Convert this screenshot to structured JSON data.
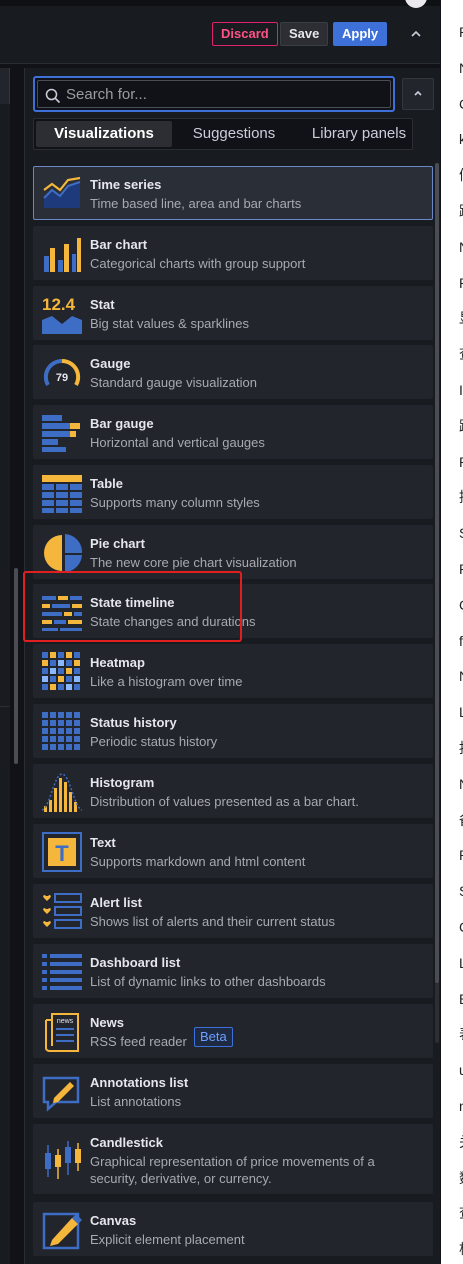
{
  "toolbar": {
    "discard_label": "Discard",
    "save_label": "Save",
    "apply_label": "Apply",
    "collapse_glyph": "⌃"
  },
  "search": {
    "placeholder": "Search for...",
    "value": ""
  },
  "collapse_glyph": "⌃",
  "tabs": [
    {
      "label": "Visualizations",
      "active": true
    },
    {
      "label": "Suggestions",
      "active": false
    },
    {
      "label": "Library panels",
      "active": false
    }
  ],
  "visualizations": [
    {
      "name": "Time series",
      "description": "Time based line, area and bar charts",
      "icon": "time-series-icon",
      "selected": true
    },
    {
      "name": "Bar chart",
      "description": "Categorical charts with group support",
      "icon": "bar-chart-icon"
    },
    {
      "name": "Stat",
      "description": "Big stat values & sparklines",
      "icon": "stat-icon",
      "icon_text": "12.4"
    },
    {
      "name": "Gauge",
      "description": "Standard gauge visualization",
      "icon": "gauge-icon",
      "icon_text": "79"
    },
    {
      "name": "Bar gauge",
      "description": "Horizontal and vertical gauges",
      "icon": "bar-gauge-icon"
    },
    {
      "name": "Table",
      "description": "Supports many column styles",
      "icon": "table-icon"
    },
    {
      "name": "Pie chart",
      "description": "The new core pie chart visualization",
      "icon": "pie-chart-icon"
    },
    {
      "name": "State timeline",
      "description": "State changes and durations",
      "icon": "state-timeline-icon",
      "highlighted": true
    },
    {
      "name": "Heatmap",
      "description": "Like a histogram over time",
      "icon": "heatmap-icon"
    },
    {
      "name": "Status history",
      "description": "Periodic status history",
      "icon": "status-history-icon"
    },
    {
      "name": "Histogram",
      "description": "Distribution of values presented as a bar chart.",
      "icon": "histogram-icon"
    },
    {
      "name": "Text",
      "description": "Supports markdown and html content",
      "icon": "text-icon",
      "icon_text": "T"
    },
    {
      "name": "Alert list",
      "description": "Shows list of alerts and their current status",
      "icon": "alert-list-icon"
    },
    {
      "name": "Dashboard list",
      "description": "List of dynamic links to other dashboards",
      "icon": "dashboard-list-icon"
    },
    {
      "name": "News",
      "description": "RSS feed reader",
      "icon": "news-icon",
      "icon_text": "news",
      "badge": "Beta"
    },
    {
      "name": "Annotations list",
      "description": "List annotations",
      "icon": "annotations-list-icon"
    },
    {
      "name": "Candlestick",
      "description": "Graphical representation of price movements of a security, derivative, or currency.",
      "icon": "candlestick-icon"
    },
    {
      "name": "Canvas",
      "description": "Explicit element placement",
      "icon": "canvas-icon"
    }
  ],
  "right_edge_chars": [
    "P",
    "N",
    "C",
    "k",
    "候",
    "跟",
    "N",
    "P",
    "显",
    "查",
    "I",
    "路",
    "P",
    "提",
    "S",
    "P",
    "C",
    "f",
    "N",
    "L",
    "按",
    "N",
    "备",
    "P",
    "S",
    "C",
    "L",
    "B",
    "表",
    "u",
    "n",
    "关",
    "数",
    "查",
    "根"
  ],
  "colors": {
    "accent": "#3d71d9",
    "discard": "#ff5286",
    "highlight": "#e02020",
    "icon_yellow": "#f5b73b",
    "icon_blue": "#3e6dc5"
  }
}
